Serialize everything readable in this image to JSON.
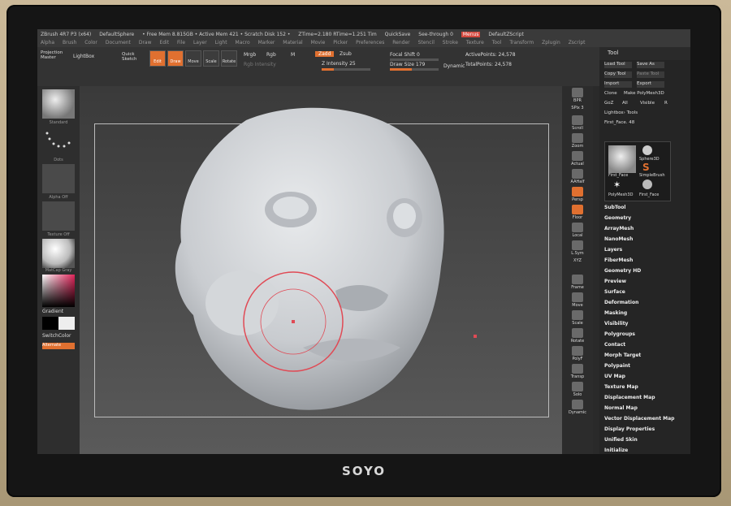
{
  "brand": "SOYO",
  "menubar": {
    "row1": [
      "ZBrush 4R7 P3 (x64)",
      "DefaultSphere",
      "• Free Mem 8.815GB • Active Mem 421 • Scratch Disk 152 •",
      "ZTime=2.180 RTime=1.251 Tim",
      "QuickSave",
      "See-through 0",
      "Menus",
      "DefaultZScript"
    ],
    "row2": [
      "Alpha",
      "Brush",
      "Color",
      "Document",
      "Draw",
      "Edit",
      "File",
      "Layer",
      "Light",
      "Macro",
      "Marker",
      "Material",
      "Movie",
      "Picker",
      "Preferences",
      "Render",
      "Stencil",
      "Stroke",
      "Texture",
      "Tool",
      "Transform",
      "Zplugin",
      "Zscript"
    ]
  },
  "toolbar": {
    "projection_master": "Projection Master",
    "lightbox": "LightBox",
    "quick_sketch": "Quick Sketch",
    "edit": "Edit",
    "draw": "Draw",
    "move": "Move",
    "scale": "Scale",
    "rotate": "Rotate",
    "mrgb": "Mrgb",
    "rgb": "Rgb",
    "m": "M",
    "rgb_intensity": "Rgb Intensity",
    "zadd": "Zadd",
    "zsub": "Zsub",
    "z_intensity_label": "Z Intensity",
    "z_intensity_value": "25",
    "focal_shift_label": "Focal Shift",
    "focal_shift_value": "0",
    "draw_size_label": "Draw Size",
    "draw_size_value": "179",
    "dynamic": "Dynamic",
    "active_points_label": "ActivePoints:",
    "active_points_value": "24,578",
    "total_points_label": "TotalPoints:",
    "total_points_value": "24,578",
    "z_intensity_fraction": 0.25,
    "draw_size_fraction": 0.45
  },
  "leftpanel": {
    "brush_label": "Standard",
    "stroke_label": "Dots",
    "alpha_label": "Alpha Off",
    "texture_label": "Texture Off",
    "material_label": "MatCap Gray",
    "gradient": "Gradient",
    "switch_color": "SwitchColor",
    "alternate": "Alternate"
  },
  "rightstrip": [
    "BPR",
    "SPix 3",
    "Scroll",
    "Zoom",
    "Actual",
    "AAHalf",
    "Persp",
    "Floor",
    "Local",
    "L.Sym",
    "XYZ",
    "Frame",
    "Move",
    "Scale",
    "Rotate",
    "PolyF",
    "Transp",
    "Solo",
    "Dynamic"
  ],
  "tray": {
    "title": "Tool",
    "load_tool": "Load Tool",
    "save_as": "Save As",
    "copy_tool": "Copy Tool",
    "paste_tool": "Paste Tool",
    "import": "Import",
    "export": "Export",
    "clone": "Clone",
    "make_polymesh": "Make PolyMesh3D",
    "goz": "GoZ",
    "all": "All",
    "visible": "Visible",
    "r": "R",
    "lightbox_tools": "Lightbox› Tools",
    "current_tool": "First_Face. 48",
    "meshes": [
      "First_Face",
      "Sphere3D",
      "SimpleBrush",
      "PolyMesh3D",
      "First_Face"
    ],
    "sections": [
      "SubTool",
      "Geometry",
      "ArrayMesh",
      "NanoMesh",
      "Layers",
      "FiberMesh",
      "Geometry HD",
      "Preview",
      "Surface",
      "Deformation",
      "Masking",
      "Visibility",
      "Polygroups",
      "Contact",
      "Morph Target",
      "Polypaint",
      "UV Map",
      "Texture Map",
      "Displacement Map",
      "Normal Map",
      "Vector Displacement Map",
      "Display Properties",
      "Unified Skin",
      "Initialize"
    ]
  },
  "colors": {
    "accent": "#e07030",
    "brush_ring": "#e04a55",
    "clay": "#d9dcdf"
  }
}
